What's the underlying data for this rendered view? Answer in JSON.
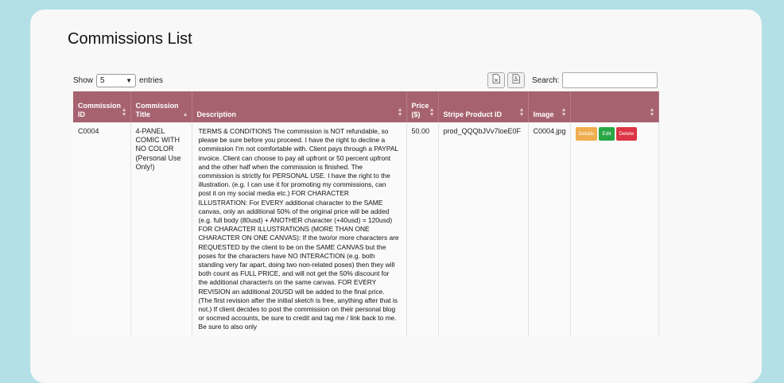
{
  "page": {
    "title": "Commissions List"
  },
  "length_control": {
    "show_label": "Show",
    "value": "5",
    "entries_label": "entries"
  },
  "search": {
    "label": "Search:",
    "placeholder": ""
  },
  "export_buttons": [
    {
      "icon": "excel-file-icon"
    },
    {
      "icon": "pdf-file-icon"
    }
  ],
  "table": {
    "headers": [
      {
        "label": "Commission ID"
      },
      {
        "label": "Commission Title"
      },
      {
        "label": "Description"
      },
      {
        "label": "Price ($)"
      },
      {
        "label": "Stripe Product ID"
      },
      {
        "label": "Image"
      },
      {
        "label": ""
      }
    ],
    "rows": [
      {
        "id": "C0004",
        "title": "4-PANEL COMIC WITH NO COLOR (Personal Use Only!)",
        "description": "TERMS & CONDITIONS The commission is NOT refundable, so please be sure before you proceed. I have the right to decline a commission I'm not comfortable with. Client pays through a PAYPAL invoice. Client can choose to pay all upfront or 50 percent upfront and the other half when the commission is finished. The commission is strictly for PERSONAL USE. I have the right to the illustration. (e.g. I can use it for promoting my commissions, can post it on my social media etc.) FOR CHARACTER ILLUSTRATION: For EVERY additional character to the SAME canvas, only an additional 50% of the original price will be added (e.g. full body (80usd) + ANOTHER character (+40usd) = 120usd) FOR CHARACTER ILLUSTRATIONS (MORE THAN ONE CHARACTER ON ONE CANVAS): If the two/or more characters are REQUESTED by the client to be on the SAME CANVAS but the poses for the characters have NO INTERACTION (e.g. both standing very far apart, doing two non-related poses) then they will both count as FULL PRICE, and will not get the 50% discount for the additional character/s on the same canvas. FOR EVERY REVISION an additional 20USD will be added to the final price. (The first revision after the initial sketch is free, anything after that is not.) If client decides to post the commission on their personal blog or socmed accounts, be sure to credit and tag me / link back to me. Be sure to also only",
        "price": "50.00",
        "stripe_id": "prod_QQQbJVv7loeE0F",
        "image": "C0004.jpg",
        "actions": {
          "details": "Details",
          "edit": "Edit",
          "delete": "Delete"
        }
      }
    ]
  },
  "colors": {
    "background": "#b2e0e6",
    "header": "#a6636f",
    "details": "#f0ad4e",
    "edit": "#28a745",
    "delete": "#dc3545"
  }
}
